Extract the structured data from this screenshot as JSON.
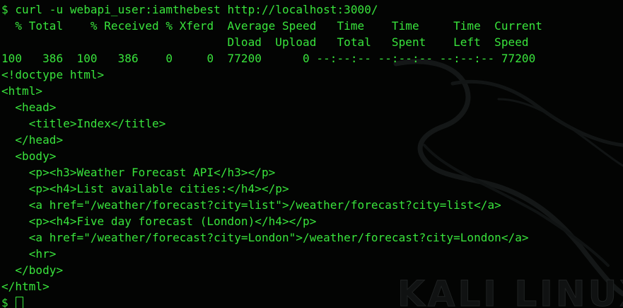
{
  "theme": {
    "background": "#030403",
    "text_color": "#39e43c"
  },
  "watermark": {
    "text": "KALI LINUX",
    "icon": "kali-dragon-icon"
  },
  "terminal": {
    "lines": [
      "$ curl -u webapi_user:iamthebest http://localhost:3000/",
      "  % Total    % Received % Xferd  Average Speed   Time    Time     Time  Current",
      "                                 Dload  Upload   Total   Spent    Left  Speed",
      "100   386  100   386    0     0  77200      0 --:--:-- --:--:-- --:--:-- 77200",
      "<!doctype html>",
      "<html>",
      "  <head>",
      "    <title>Index</title>",
      "  </head>",
      "  <body>",
      "    <p><h3>Weather Forecast API</h3></p>",
      "    <p><h4>List available cities:</h4></p>",
      "    <a href=\"/weather/forecast?city=list\">/weather/forecast?city=list</a>",
      "    <p><h4>Five day forecast (London)</h4></p>",
      "    <a href=\"/weather/forecast?city=London\">/weather/forecast?city=London</a>",
      "    <hr>",
      "  </body>",
      "</html>"
    ],
    "prompt": "$ "
  }
}
